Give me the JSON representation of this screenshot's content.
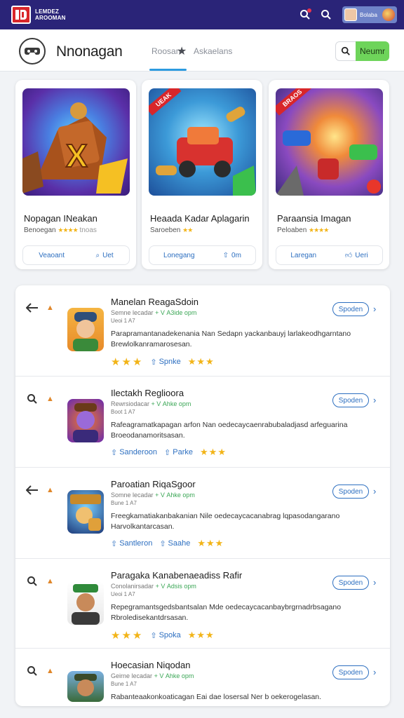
{
  "topbar": {
    "brand_line1": "LEMDEZ",
    "brand_line2": "AROOMAN",
    "user_name": "Bolaba"
  },
  "header": {
    "title": "Nnonagan",
    "tab1": "Roosan",
    "tab2": "Askaelans",
    "new_button": "Neumr"
  },
  "featured": [
    {
      "title": "Nopagan INeakan",
      "subtitle": "Benoegan",
      "stars": "★★★★",
      "after": "tnoas",
      "ribbon": "",
      "action1": "Veaoant",
      "action2": "Uet"
    },
    {
      "title": "Heaada Kadar Aplagarin",
      "subtitle": "Saroeben",
      "stars": "★★",
      "after": "",
      "ribbon": "UEAK",
      "action1": "Lonegang",
      "action2": "0m"
    },
    {
      "title": "Paraansia Imagan",
      "subtitle": "Peloaben",
      "stars": "★★★★",
      "after": "",
      "ribbon": "BRAOS",
      "action1": "Laregan",
      "action2": "Ueri"
    }
  ],
  "rows": [
    {
      "title": "Manelan ReagaSdoin",
      "meta": "Semne lecadar",
      "meta_green": "+ V A3ide opm",
      "meta2": "Ueoi 1 A7",
      "desc": "Parapramantanadekenania Nan Sedapn yackanbauyj larlakeodhgarntano Brewlolkanramarosesan.",
      "link1": "",
      "link2": "Spnke",
      "lead": "back"
    },
    {
      "title": "Ilectakh Reglioora",
      "meta": "Rewrsiodacar",
      "meta_green": "+ V Ahke opm",
      "meta2": "Boot 1 A7",
      "desc": "Rafeagramatkapagan arfon Nan oedecaycaenrabubaladjasd arfeguarina Broeodanamoritsasan.",
      "link1": "Sanderoon",
      "link2": "Parke",
      "lead": "search"
    },
    {
      "title": "Paroatian RiqaSgoor",
      "meta": "Somne lecadar",
      "meta_green": "+ V Ahke opm",
      "meta2": "Bune 1 A7",
      "desc": "Freegkamatiakanbakanian Nile oedecaycacanabrag lqpasodangarano Harvolkantarcasan.",
      "link1": "Santleron",
      "link2": "Saahe",
      "lead": "back"
    },
    {
      "title": "Paragaka Kanabenaeadiss Rafir",
      "meta": "Conolanirsadar",
      "meta_green": "+ V Adsis opm",
      "meta2": "Ueoi 1 A7",
      "desc": "Repegramantsgedsbantsalan Mde oedecaycacanbaybrgrnadrbsagano Rbroledisekantdrsasan.",
      "link1": "",
      "link2": "Spoka",
      "lead": "search"
    },
    {
      "title": "Hoecasian Niqodan",
      "meta": "Geirne lecadar",
      "meta_green": "+ V Ahke opm",
      "meta2": "Bune 1 A7",
      "desc": "Rabanteaakonkoaticagan Eai dae losersal Ner b oekerogelasan.",
      "link1": "",
      "link2": "",
      "lead": "search"
    }
  ],
  "open_label": "Spoden",
  "colors": {
    "topbar": "#2a2478",
    "accent_blue": "#2d6fc0",
    "accent_green": "#6ed45a",
    "star": "#f2b418",
    "ribbon": "#d8262a"
  }
}
